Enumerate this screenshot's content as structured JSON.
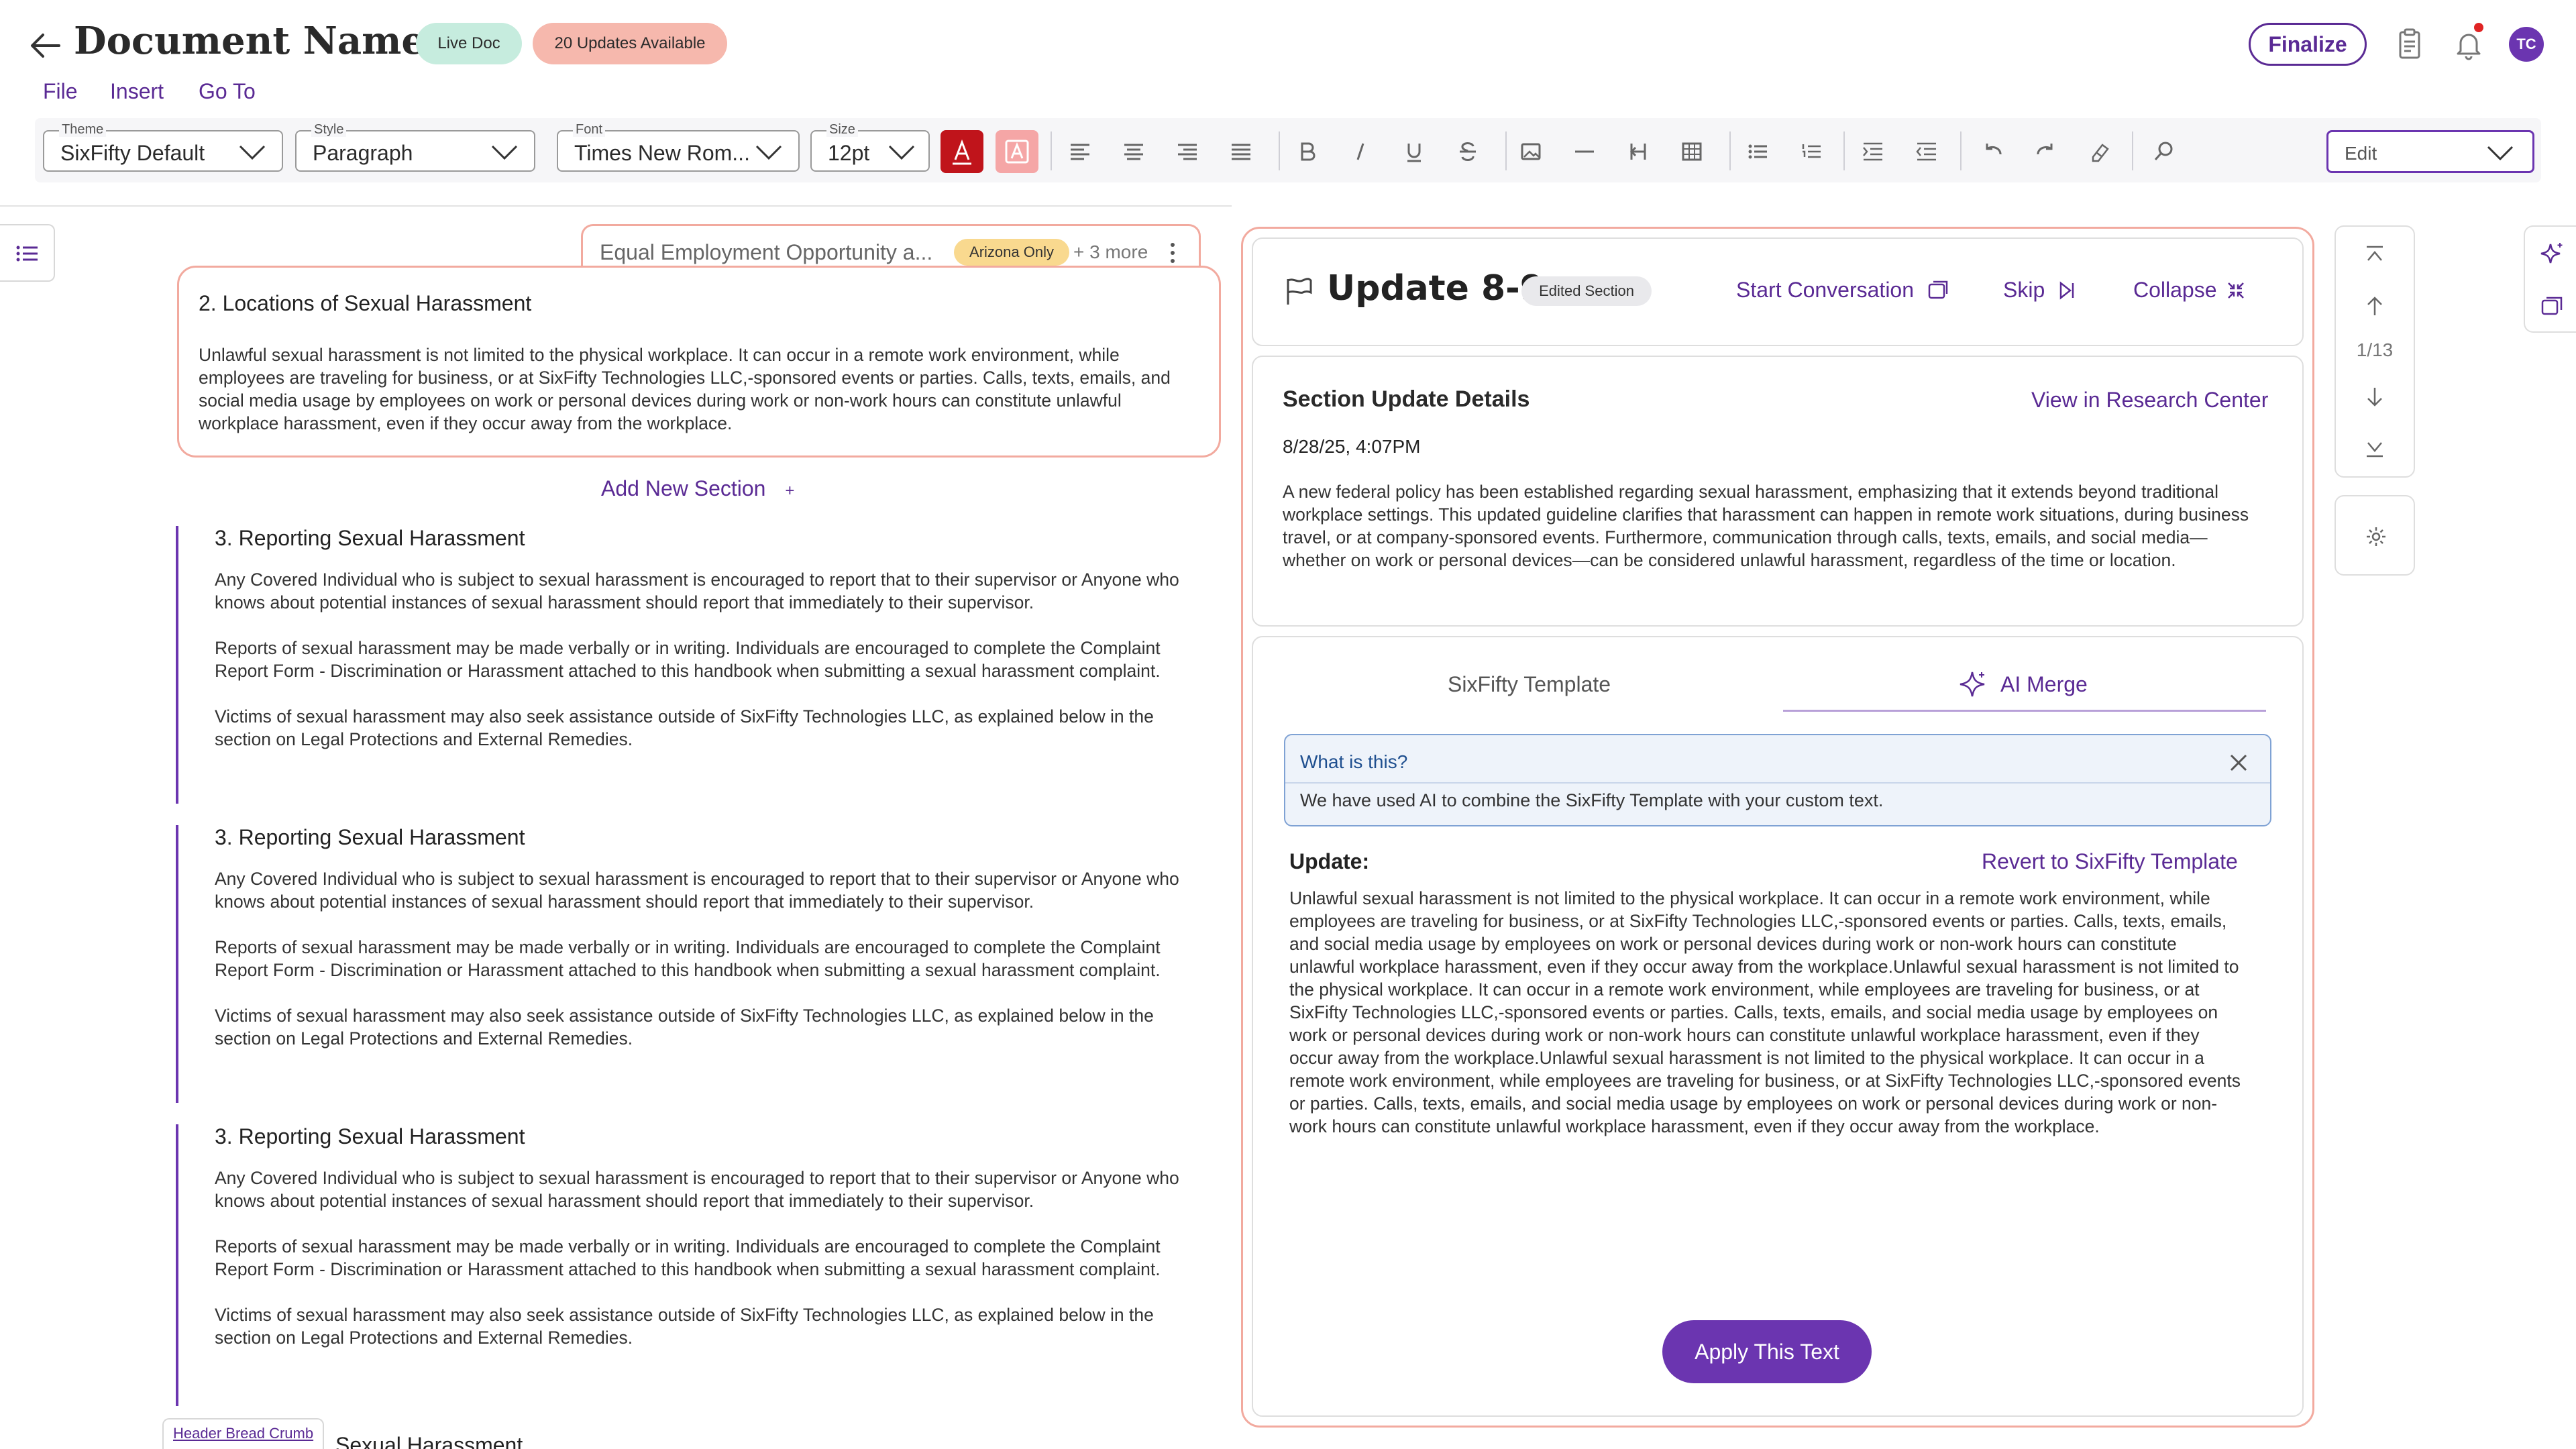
{
  "header": {
    "title": "Document Name",
    "live_label": "Live Doc",
    "updates_label": "20 Updates Available",
    "finalize_label": "Finalize",
    "avatar_initials": "TC"
  },
  "menu": {
    "file": "File",
    "insert": "Insert",
    "goto": "Go To"
  },
  "toolbar": {
    "theme_label": "Theme",
    "theme_value": "SixFifty Default",
    "style_label": "Style",
    "style_value": "Paragraph",
    "font_label": "Font",
    "font_value": "Times New Rom...",
    "size_label": "Size",
    "size_value": "12pt",
    "mode_value": "Edit",
    "icons": [
      "align-left-icon",
      "align-center-icon",
      "align-right-icon",
      "align-justify-icon",
      "bold-icon",
      "italic-icon",
      "underline-icon",
      "strikethrough-icon",
      "image-icon",
      "horizontal-rule-icon",
      "page-break-icon",
      "table-icon",
      "bulleted-list-icon",
      "numbered-list-icon",
      "indent-icon",
      "outdent-icon",
      "undo-icon",
      "redo-icon",
      "clear-format-icon",
      "search-icon"
    ]
  },
  "editor": {
    "active_tab": {
      "title": "Equal Employment Opportunity a...",
      "tag": "Arizona Only",
      "more": "+ 3 more"
    },
    "active_section": {
      "title": "2. Locations of Sexual Harassment",
      "body": "Unlawful sexual harassment is not limited to the physical workplace. It can occur in a remote work environment, while employees are traveling for business, or at SixFifty Technologies LLC,-sponsored events or parties. Calls, texts, emails, and social media usage by employees on work or personal devices during work or non-work hours can constitute unlawful workplace harassment, even if they occur away from the workplace."
    },
    "add_section_label": "Add New Section",
    "add_section_plus": "+",
    "sections": [
      {
        "title": "3. Reporting Sexual Harassment",
        "p1": "Any Covered Individual who is subject to sexual harassment is encouraged to report that to their supervisor or Anyone who knows about potential instances of sexual harassment should report that immediately to their supervisor.",
        "p2": "Reports of sexual harassment may be made verbally or in writing. Individuals are encouraged to complete the Complaint Report Form - Discrimination or Harassment attached to this handbook when submitting a sexual harassment complaint.",
        "p3": "Victims of sexual harassment may also seek assistance outside of SixFifty Technologies LLC, as explained below in the section on Legal Protections and External Remedies."
      },
      {
        "title": "3. Reporting Sexual Harassment",
        "p1": "Any Covered Individual who is subject to sexual harassment is encouraged to report that to their supervisor or Anyone who knows about potential instances of sexual harassment should report that immediately to their supervisor.",
        "p2": "Reports of sexual harassment may be made verbally or in writing. Individuals are encouraged to complete the Complaint Report Form - Discrimination or Harassment attached to this handbook when submitting a sexual harassment complaint.",
        "p3": "Victims of sexual harassment may also seek assistance outside of SixFifty Technologies LLC, as explained below in the section on Legal Protections and External Remedies."
      },
      {
        "title": "3. Reporting Sexual Harassment",
        "p1": "Any Covered Individual who is subject to sexual harassment is encouraged to report that to their supervisor or Anyone who knows about potential instances of sexual harassment should report that immediately to their supervisor.",
        "p2": "Reports of sexual harassment may be made verbally or in writing. Individuals are encouraged to complete the Complaint Report Form - Discrimination or Harassment attached to this handbook when submitting a sexual harassment complaint.",
        "p3": "Victims of sexual harassment may also seek assistance outside of SixFifty Technologies LLC, as explained below in the section on Legal Protections and External Remedies."
      }
    ],
    "breadcrumb_label": "Header Bread Crumb",
    "cut_heading": "Sexual Harassment"
  },
  "update_panel": {
    "title": "Update 8-9",
    "badge": "Edited  Section",
    "start_conversation": "Start Conversation",
    "skip": "Skip",
    "collapse": "Collapse",
    "details_title": "Section Update Details",
    "research_link": "View in Research Center",
    "date": "8/28/25, 4:07PM",
    "details_body": "A new federal policy has been established regarding sexual harassment, emphasizing that it extends beyond traditional workplace settings. This updated guideline clarifies that harassment can happen in remote work situations, during business travel, or at company-sponsored events. Furthermore, communication through calls, texts, emails, and social media—whether on work or personal devices—can be considered unlawful harassment, regardless of the time or location.",
    "tab_template": "SixFifty Template",
    "tab_ai": "AI Merge",
    "info_question": "What is this?",
    "info_text": "We have used AI to combine the SixFifty Template with your custom text.",
    "update_label": "Update:",
    "revert_label": "Revert to SixFifty Template",
    "update_body": "Unlawful sexual harassment is not limited to the physical workplace. It can occur in a remote work environment, while employees are traveling for business, or at SixFifty Technologies LLC,-sponsored events or parties. Calls, texts, emails, and social media usage by employees on work or personal devices during work or non-work hours can constitute unlawful workplace harassment, even if they occur away from the workplace.Unlawful sexual harassment is not limited to the physical workplace. It can occur in a remote work environment, while employees are traveling for business, or at SixFifty Technologies LLC,-sponsored events or parties. Calls, texts, emails, and social media usage by employees on work or personal devices during work or non-work hours can constitute unlawful workplace harassment, even if they occur away from the workplace.Unlawful sexual harassment is not limited to the physical workplace. It can occur in a remote work environment, while employees are traveling for business, or at SixFifty Technologies LLC,-sponsored events or parties. Calls, texts, emails, and social media usage by employees on work or personal devices during work or non-work hours can constitute unlawful workplace harassment, even if they occur away from the workplace.",
    "apply_label": "Apply This Text"
  },
  "nav": {
    "count": "1/13"
  },
  "colors": {
    "accent": "#6b35b0",
    "live": "#c6ecde",
    "updates": "#f6b8ad",
    "section_border": "#f2aa9f",
    "arizona": "#f9d98f"
  }
}
